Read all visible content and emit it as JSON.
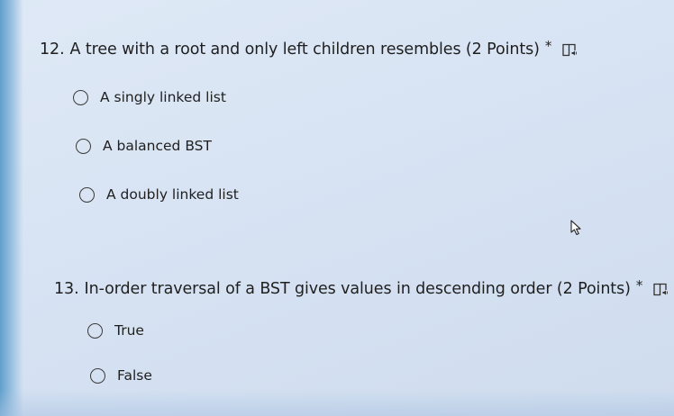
{
  "questions": [
    {
      "number": "12.",
      "text": "A tree with a root and only left children resembles (2 Points)",
      "required_marker": "*",
      "icon": "immersive-reader-icon",
      "options": [
        "A singly linked list",
        "A balanced BST",
        "A doubly linked list"
      ]
    },
    {
      "number": "13.",
      "text": "In-order traversal of a BST gives values in descending order (2 Points)",
      "required_marker": "*",
      "icon": "immersive-reader-icon",
      "options": [
        "True",
        "False"
      ]
    }
  ],
  "colors": {
    "background": "#d7e3f3",
    "text": "#1f1f1f",
    "radio_border": "#3b3b3b"
  }
}
